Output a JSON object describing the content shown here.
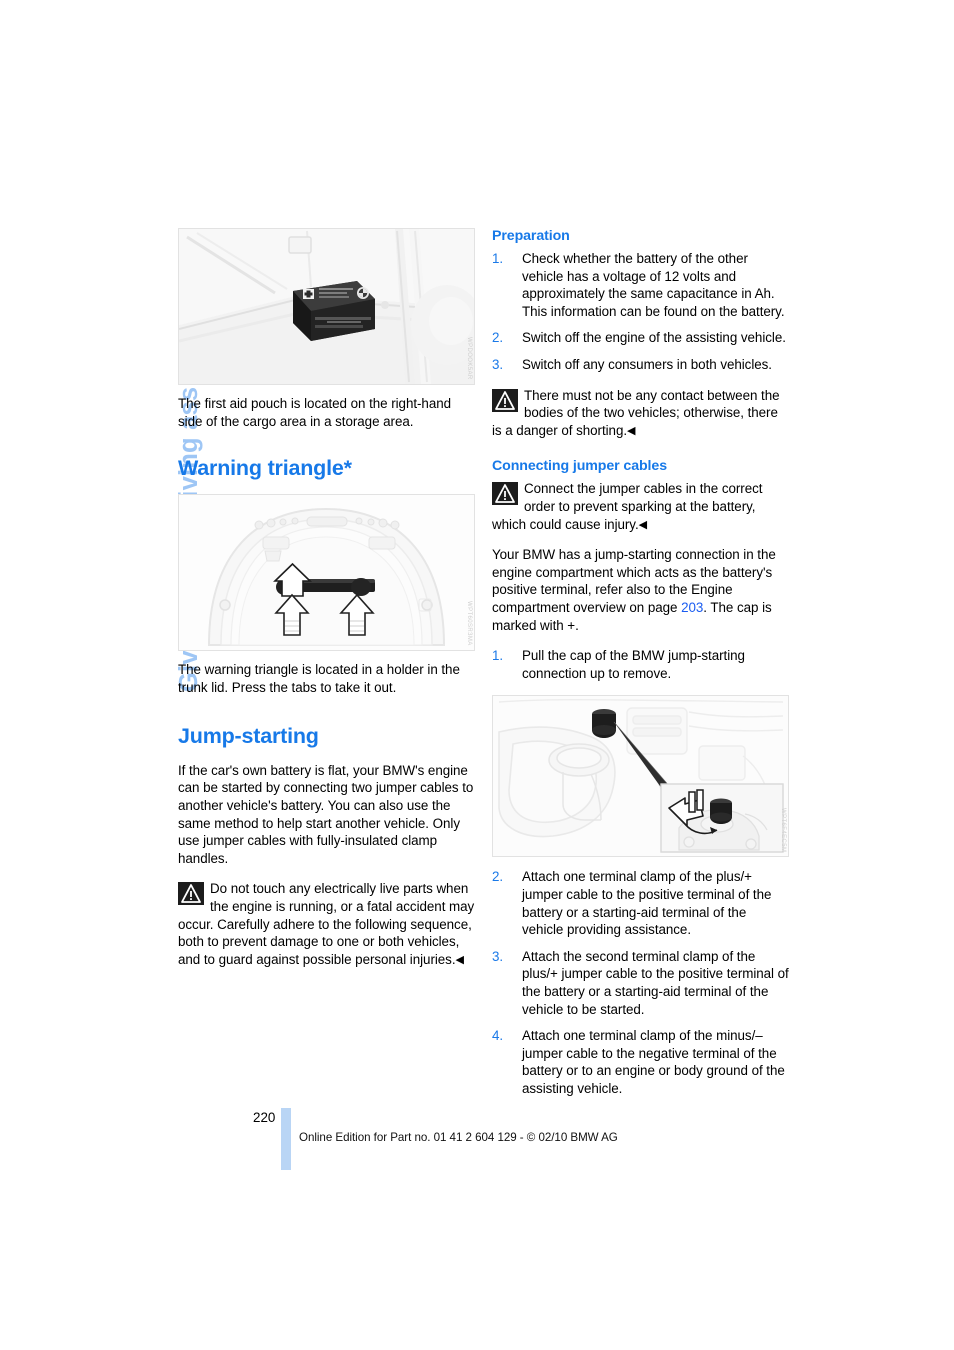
{
  "chapter": {
    "tab_label": "Giving and receiving assistance"
  },
  "colors": {
    "heading_blue": "#1779e8",
    "tab_blue": "#9ec6f5",
    "link_blue": "#1a5cf0",
    "footer_bar_blue": "#b9d5f5"
  },
  "left_column": {
    "figure_first_aid": {
      "caption": "The first aid pouch is located on the right-hand side of the cargo area in a storage area.",
      "code": "WPDOOK5AR"
    },
    "warning_triangle": {
      "heading": "Warning triangle*",
      "figure_code": "WPT60SR3MA",
      "caption": "The warning triangle is located in a holder in the trunk lid. Press the tabs to take it out."
    },
    "jump_starting": {
      "heading": "Jump-starting",
      "intro": "If the car's own battery is flat, your BMW's engine can be started by connecting two jumper cables to another vehicle's battery. You can also use the same method to help start another vehicle. Only use jumper cables with fully-insulated clamp handles.",
      "warning": "Do not touch any electrically live parts when the engine is running, or a fatal accident may occur. Carefully adhere to the following sequence, both to prevent damage to one or both vehicles, and to guard against possible personal injuries.",
      "warning_endmark": "◀"
    }
  },
  "right_column": {
    "preparation": {
      "heading": "Preparation",
      "steps": [
        {
          "num": "1.",
          "text": "Check whether the battery of the other vehicle has a voltage of 12 volts and approximately the same capacitance in Ah. This information can be found on the battery."
        },
        {
          "num": "2.",
          "text": "Switch off the engine of the assisting vehicle."
        },
        {
          "num": "3.",
          "text": "Switch off any consumers in both vehicles."
        }
      ],
      "warning": "There must not be any contact between the bodies of the two vehicles; otherwise, there is a danger of shorting.",
      "warning_endmark": "◀"
    },
    "connecting_jumper_cables": {
      "heading": "Connecting jumper cables",
      "warning": "Connect the jumper cables in the correct order to prevent sparking at the battery, which could cause injury.",
      "warning_endmark": "◀",
      "paragraph_before": "Your BMW has a jump-starting connection in the engine compartment which acts as the battery's positive terminal, refer also to the Engine compartment overview on page ",
      "page_reference": "203",
      "paragraph_after": ". The cap is marked with +.",
      "step1": {
        "num": "1.",
        "text": "Pull the cap of the BMW jump-starting connection up to remove."
      },
      "figure_code": "WPT6F4EC5M",
      "steps": [
        {
          "num": "2.",
          "text": "Attach one terminal clamp of the plus/+ jumper cable to the positive terminal of the battery or a starting-aid terminal of the vehicle providing assistance."
        },
        {
          "num": "3.",
          "text": "Attach the second terminal clamp of the plus/+ jumper cable to the positive terminal of the battery or a starting-aid terminal of the vehicle to be started."
        },
        {
          "num": "4.",
          "text": "Attach one terminal clamp of the minus/– jumper cable to the negative terminal of the battery or to an engine or body ground of the assisting vehicle."
        }
      ]
    }
  },
  "footer": {
    "page_number": "220",
    "edition_text": "Online Edition for Part no. 01 41 2 604 129 - © 02/10 BMW AG"
  }
}
